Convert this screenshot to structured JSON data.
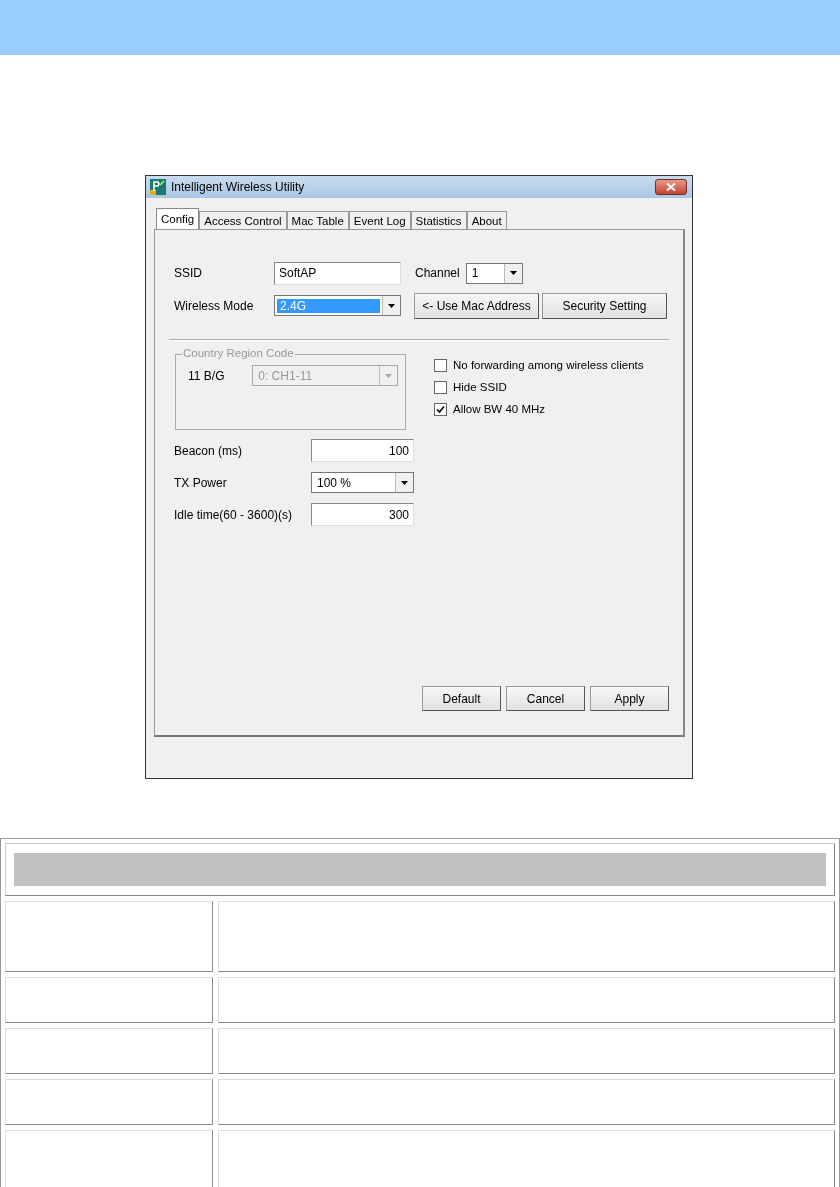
{
  "window": {
    "title": "Intelligent Wireless Utility"
  },
  "tabs": [
    {
      "label": "Config",
      "selected": true
    },
    {
      "label": "Access Control",
      "selected": false
    },
    {
      "label": "Mac Table",
      "selected": false
    },
    {
      "label": "Event Log",
      "selected": false
    },
    {
      "label": "Statistics",
      "selected": false
    },
    {
      "label": "About",
      "selected": false
    }
  ],
  "ssid": {
    "label": "SSID",
    "value": "SoftAP"
  },
  "channel": {
    "label": "Channel",
    "value": "1"
  },
  "wireless_mode": {
    "label": "Wireless Mode",
    "value": "2.4G",
    "focused": true
  },
  "top_buttons": [
    "<- Use Mac Address",
    "Security Setting"
  ],
  "country_region": {
    "title": "Country Region Code",
    "label": "11 B/G",
    "value": "0: CH1-11",
    "disabled": true
  },
  "checkboxes": [
    {
      "label": "No forwarding among wireless clients",
      "checked": false
    },
    {
      "label": "Hide SSID",
      "checked": false
    },
    {
      "label": "Allow BW 40 MHz",
      "checked": true
    }
  ],
  "settings": [
    {
      "kind": "text",
      "label": "Beacon (ms)",
      "value": "100"
    },
    {
      "kind": "select",
      "label": "TX Power",
      "value": "100 %"
    },
    {
      "kind": "text",
      "label": "Idle time(60 - 3600)(s)",
      "value": "300"
    }
  ],
  "bottom_buttons": [
    "Default",
    "Cancel",
    "Apply"
  ],
  "table": {
    "rows": [
      {
        "kind": "tall"
      },
      {
        "kind": "short"
      },
      {
        "kind": "short"
      },
      {
        "kind": "short"
      },
      {
        "kind": "tall"
      }
    ]
  }
}
